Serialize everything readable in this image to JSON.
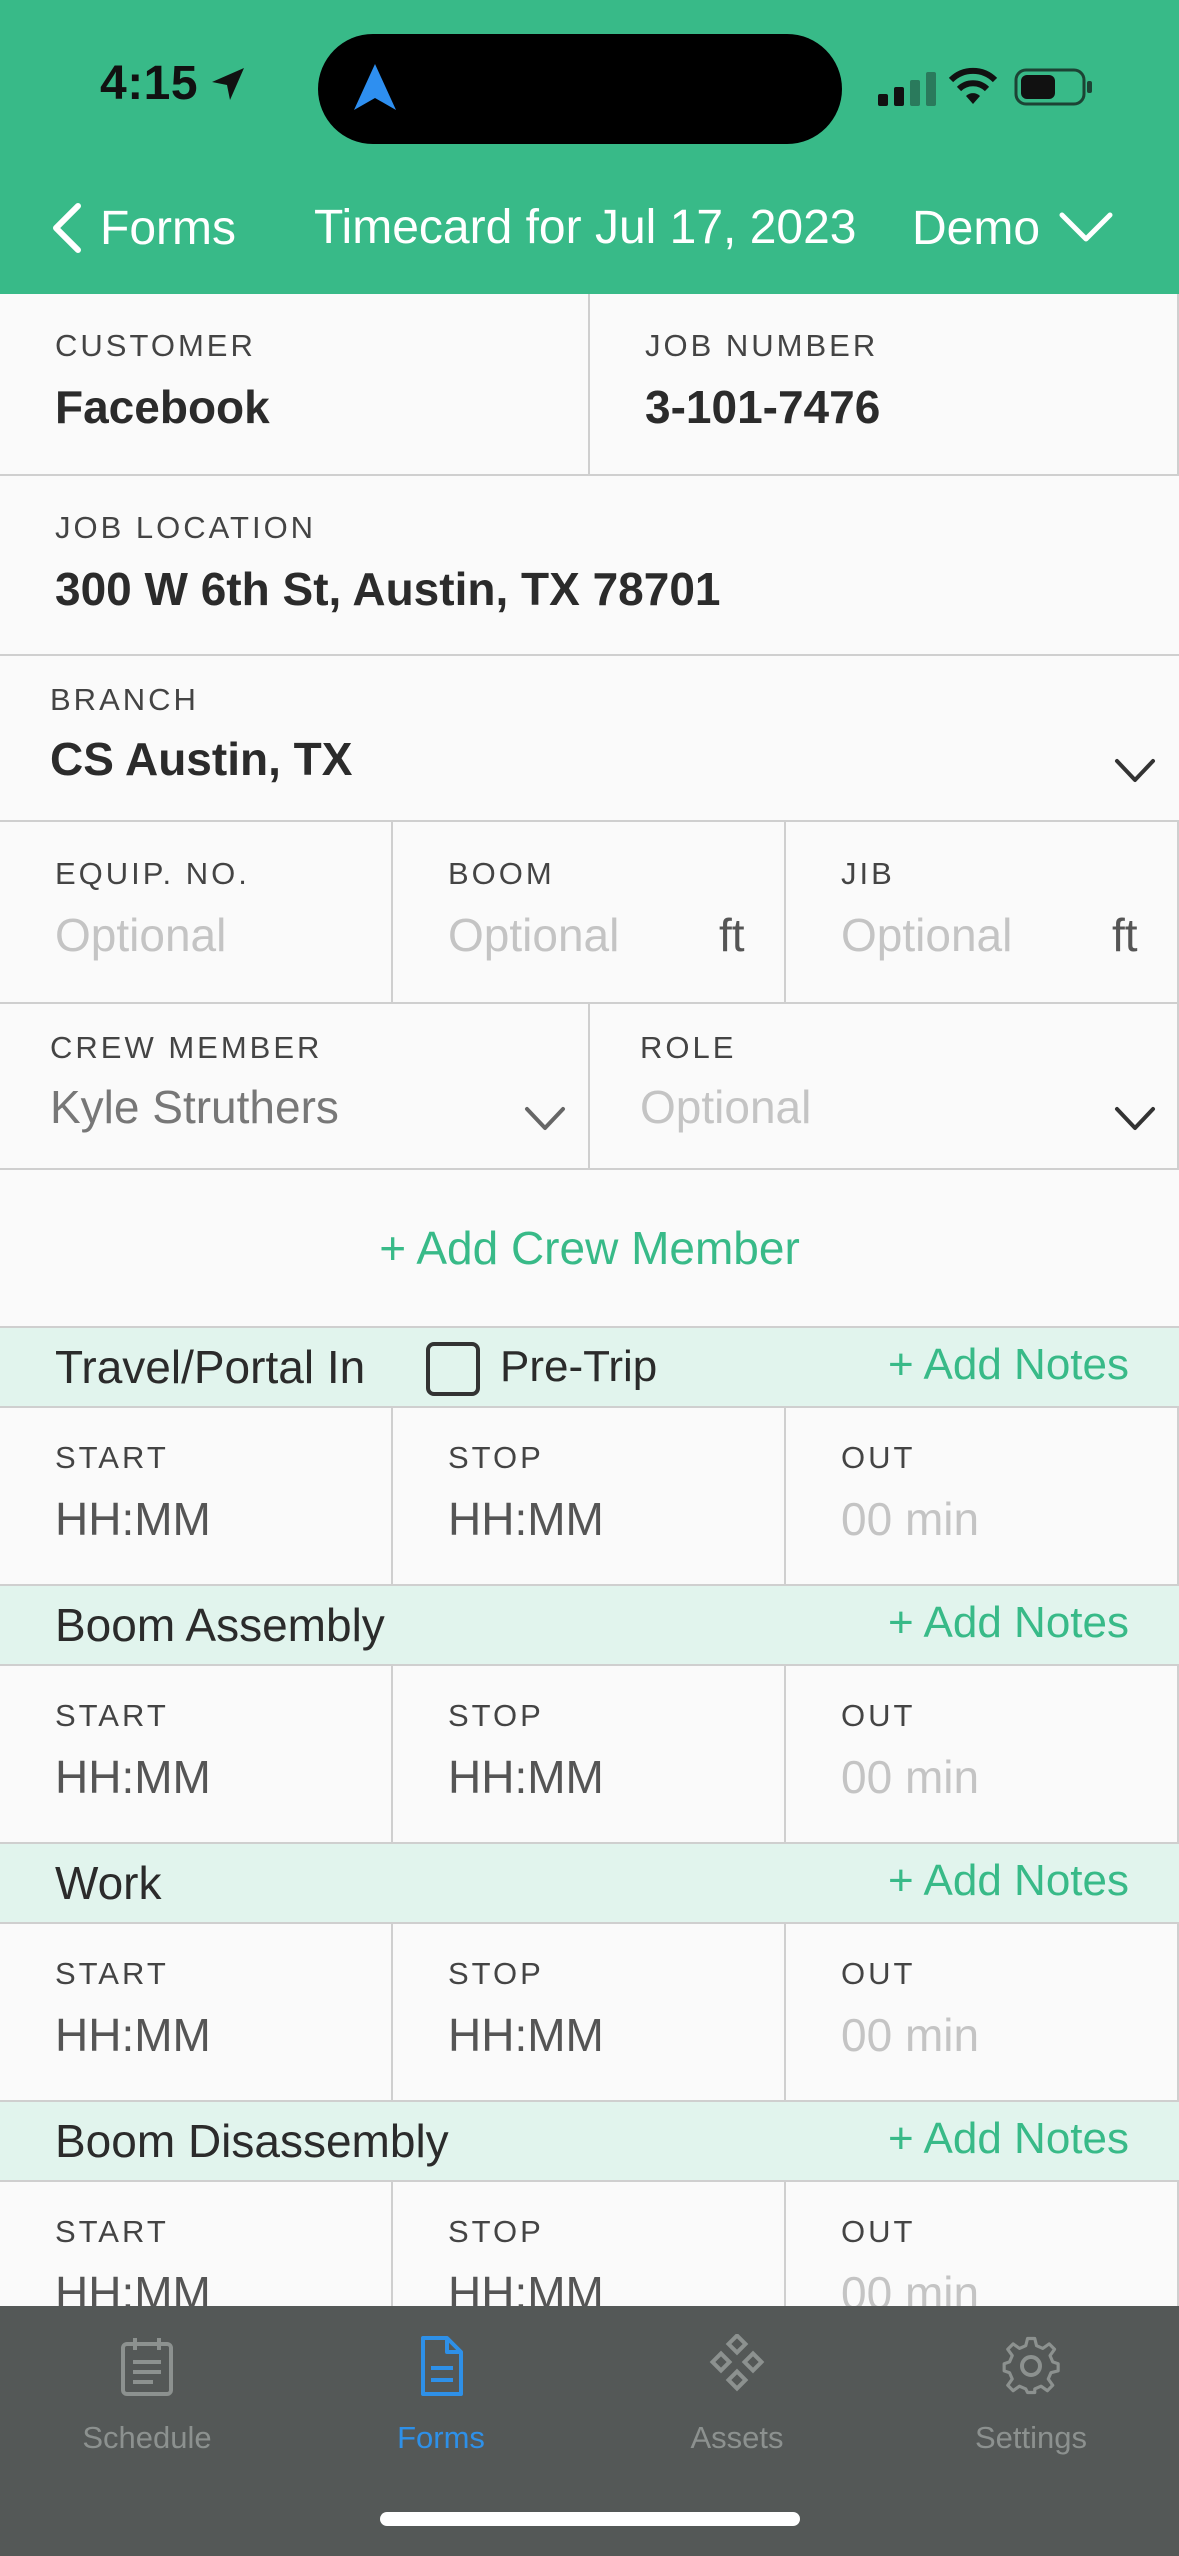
{
  "status_bar": {
    "time": "4:15"
  },
  "header": {
    "back_label": "Forms",
    "title": "Timecard for Jul 17, 2023",
    "account_label": "Demo"
  },
  "fields": {
    "customer": {
      "label": "CUSTOMER",
      "value": "Facebook"
    },
    "job_number": {
      "label": "JOB NUMBER",
      "value": "3-101-7476"
    },
    "job_location": {
      "label": "JOB LOCATION",
      "value": "300 W 6th St, Austin, TX 78701"
    },
    "branch": {
      "label": "BRANCH",
      "value": "CS Austin, TX"
    },
    "equip_no": {
      "label": "EQUIP. NO.",
      "placeholder": "Optional"
    },
    "boom": {
      "label": "BOOM",
      "placeholder": "Optional",
      "unit": "ft"
    },
    "jib": {
      "label": "JIB",
      "placeholder": "Optional",
      "unit": "ft"
    },
    "crew_member": {
      "label": "CREW MEMBER",
      "value": "Kyle Struthers"
    },
    "role": {
      "label": "ROLE",
      "placeholder": "Optional"
    }
  },
  "add_crew_label": "+ Add Crew Member",
  "pretrip_label": "Pre-Trip",
  "time_labels": {
    "start": "START",
    "stop": "STOP",
    "out": "OUT"
  },
  "time_placeholders": {
    "start": "HH:MM",
    "stop": "HH:MM",
    "out": "00 min"
  },
  "sections": [
    {
      "title": "Travel/Portal In",
      "notes": "+ Add Notes"
    },
    {
      "title": "Boom Assembly",
      "notes": "+ Add Notes"
    },
    {
      "title": "Work",
      "notes": "+ Add Notes"
    },
    {
      "title": "Boom Disassembly",
      "notes": "+ Add Notes"
    }
  ],
  "tabs": [
    {
      "label": "Schedule",
      "icon": "calendar-icon"
    },
    {
      "label": "Forms",
      "icon": "document-icon",
      "active": true
    },
    {
      "label": "Assets",
      "icon": "assets-icon"
    },
    {
      "label": "Settings",
      "icon": "gear-icon"
    }
  ],
  "colors": {
    "brand_green": "#38ba88",
    "section_bg": "#e1f4ed",
    "tabbar_bg": "#545857",
    "active_tab": "#2e90e8"
  }
}
